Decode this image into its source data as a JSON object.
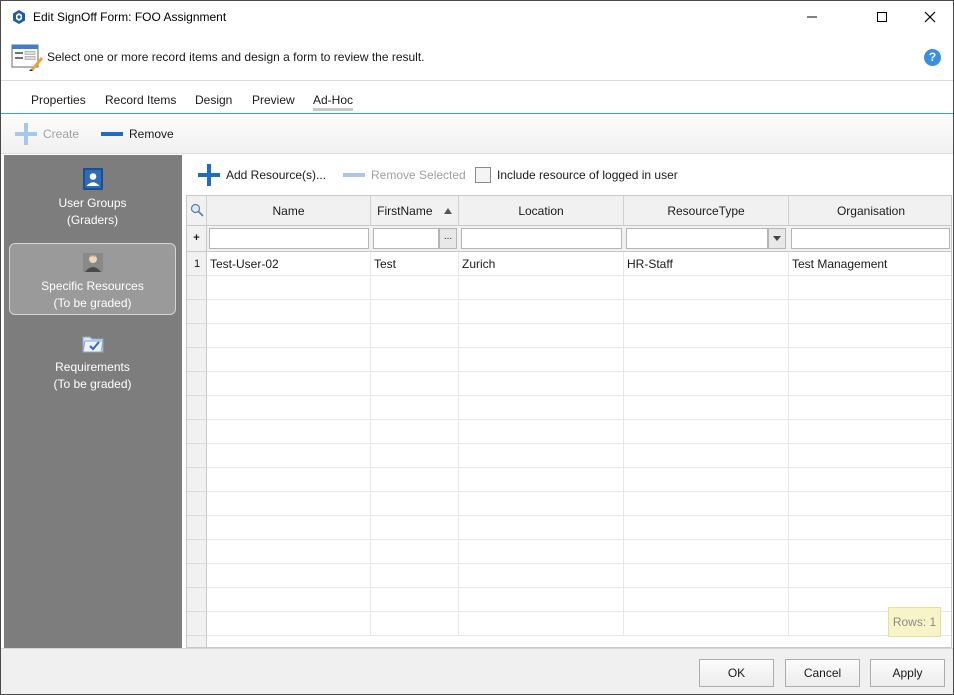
{
  "window": {
    "title": "Edit SignOff Form: FOO Assignment",
    "minimize_glyph": "—",
    "maximize_glyph": "☐",
    "close_glyph": "✕"
  },
  "instruction": {
    "text": "Select one or more record items and design a form to review the result.",
    "help_glyph": "?"
  },
  "tabs": [
    {
      "label": "Properties"
    },
    {
      "label": "Record Items"
    },
    {
      "label": "Design"
    },
    {
      "label": "Preview"
    },
    {
      "label": "Ad-Hoc",
      "active": true
    }
  ],
  "toolbar": {
    "create_label": "Create",
    "remove_label": "Remove"
  },
  "leftnav": {
    "items": [
      {
        "line1": "User Groups",
        "line2": "(Graders)",
        "icon": "user-group-icon"
      },
      {
        "line1": "Specific Resources",
        "line2": "(To be graded)",
        "icon": "person-icon",
        "selected": true
      },
      {
        "line1": "Requirements",
        "line2": "(To be graded)",
        "icon": "folder-check-icon"
      }
    ]
  },
  "resources": {
    "add_label": "Add Resource(s)...",
    "remove_selected_label": "Remove Selected",
    "include_label": "Include resource of logged in user",
    "include_checked": false
  },
  "grid": {
    "columns": [
      {
        "label": "Name"
      },
      {
        "label": "FirstName",
        "sorted": "asc"
      },
      {
        "label": "Location"
      },
      {
        "label": "ResourceType"
      },
      {
        "label": "Organisation"
      }
    ],
    "filter_ellipsis": "...",
    "rows": [
      {
        "num": "1",
        "cells": [
          "Test-User-02",
          "Test",
          "Zurich",
          "HR-Staff",
          "Test Management"
        ]
      }
    ],
    "rows_count_label": "Rows: 1"
  },
  "dialog": {
    "ok_label": "OK",
    "cancel_label": "Cancel",
    "apply_label": "Apply"
  },
  "colors": {
    "accent": "#1e6cc8",
    "nav_bg": "#7d7d7d",
    "tab_underline": "#3a9fd6"
  }
}
